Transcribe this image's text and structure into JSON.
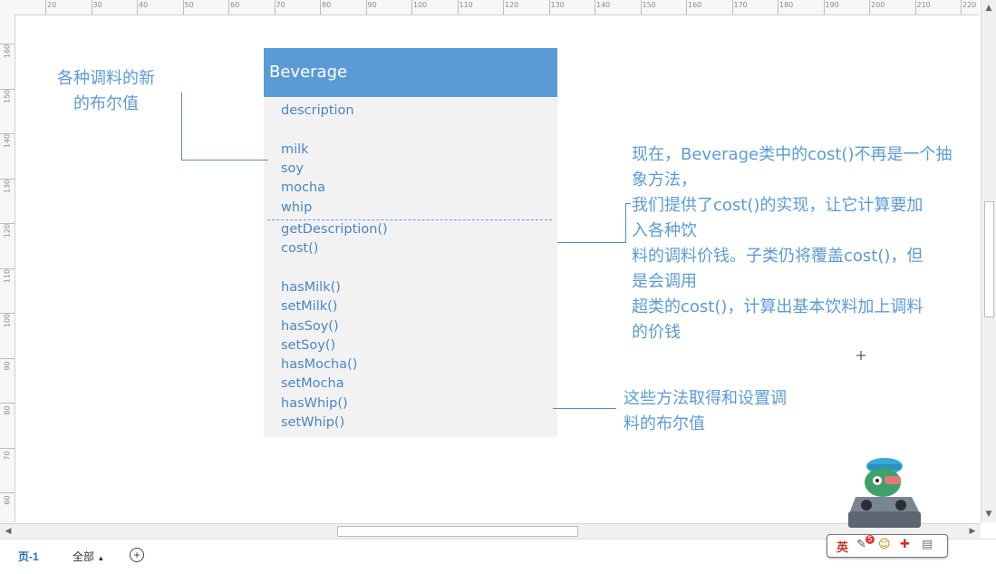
{
  "ruler": {
    "top_labels": [
      "20",
      "30",
      "40",
      "50",
      "60",
      "70",
      "80",
      "90",
      "100",
      "110",
      "120",
      "130",
      "140",
      "150",
      "160",
      "170",
      "180",
      "190",
      "200",
      "210",
      "220"
    ],
    "left_labels": [
      "160",
      "150",
      "140",
      "130",
      "120",
      "110",
      "100",
      "90",
      "80",
      "70",
      "60"
    ]
  },
  "class": {
    "name": "Beverage",
    "attributes": [
      "description",
      "",
      "milk",
      "soy",
      "mocha",
      "whip"
    ],
    "methods": [
      "getDescription()",
      "cost()",
      "",
      "hasMilk()",
      "setMilk()",
      "hasSoy()",
      "setSoy()",
      "hasMocha()",
      "setMocha",
      "hasWhip()",
      "setWhip()"
    ]
  },
  "notes": {
    "attributes_note": [
      "各种调料的新",
      "的布尔值"
    ],
    "cost_note": [
      "现在，Beverage类中的cost()不再是一个抽",
      "象方法，",
      "我们提供了cost()的实现，让它计算要加",
      "入各种饮",
      "料的调料价钱。子类仍将覆盖cost()，但",
      "是会调用",
      "超类的cost()，计算出基本饮料加上调料",
      "的价钱"
    ],
    "methods_note": [
      "这些方法取得和设置调",
      "料的布尔值"
    ]
  },
  "statusbar": {
    "page_tab": "页-1",
    "all_pages": "全部",
    "all_pages_arrow": "▲",
    "add_page": "+"
  },
  "toolbar": {
    "icons": [
      "英",
      "✎",
      "☺",
      "✚",
      "▤"
    ],
    "badge": "5"
  },
  "colors": {
    "header": "#5b9bd5",
    "text": "#4a86c5",
    "box": "#f2f2f2"
  }
}
